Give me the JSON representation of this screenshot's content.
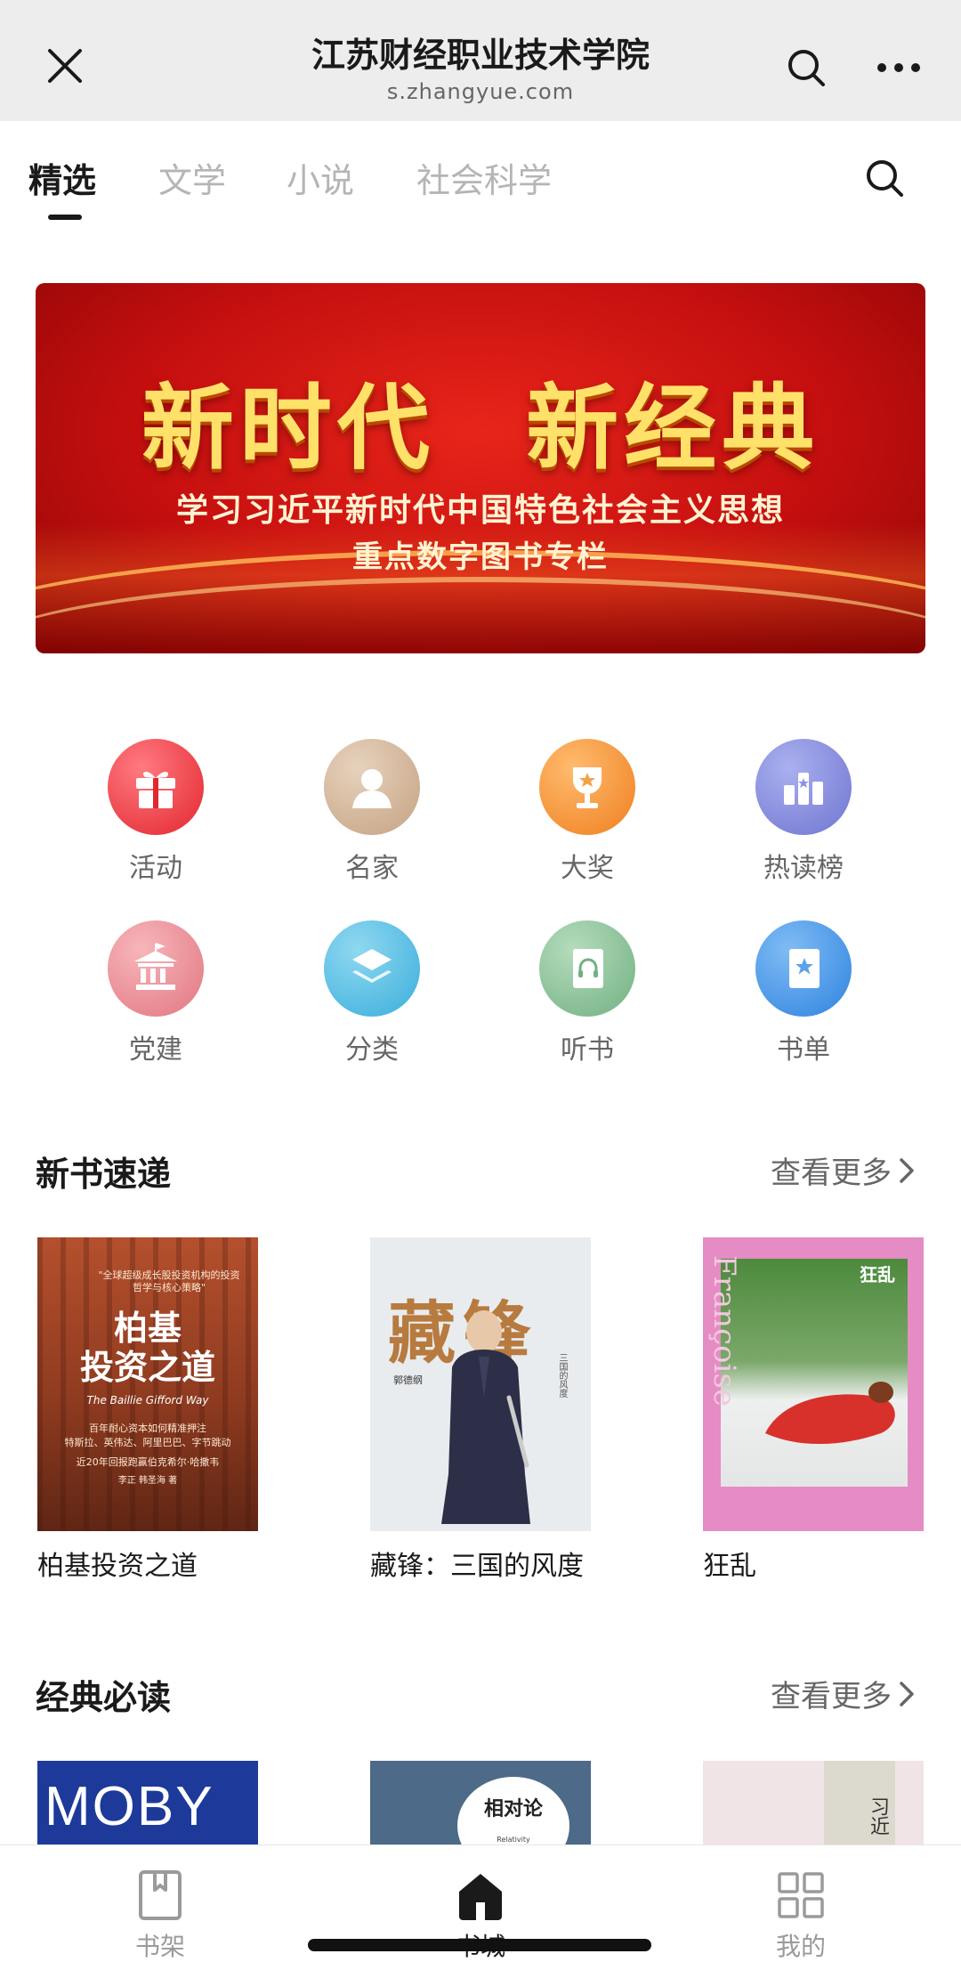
{
  "topbar": {
    "title": "江苏财经职业技术学院",
    "subtitle": "s.zhangyue.com",
    "close_icon": "close-icon",
    "search_icon": "search-icon",
    "more_icon": "more-icon"
  },
  "tabs": [
    {
      "label": "精选",
      "active": true
    },
    {
      "label": "文学",
      "active": false
    },
    {
      "label": "小说",
      "active": false
    },
    {
      "label": "社会科学",
      "active": false
    }
  ],
  "banner": {
    "headline": "新时代 新经典",
    "line1": "学习习近平新时代中国特色社会主义思想",
    "line2": "重点数字图书专栏"
  },
  "shortcuts": [
    {
      "label": "活动",
      "icon": "gift-icon",
      "color": "#e8323c"
    },
    {
      "label": "名家",
      "icon": "person-icon",
      "color": "#c8a98a"
    },
    {
      "label": "大奖",
      "icon": "trophy-icon",
      "color": "#f08a2e"
    },
    {
      "label": "热读榜",
      "icon": "ranking-icon",
      "color": "#7f85d8"
    },
    {
      "label": "党建",
      "icon": "building-icon",
      "color": "#e47a84"
    },
    {
      "label": "分类",
      "icon": "layers-icon",
      "color": "#46b6df"
    },
    {
      "label": "听书",
      "icon": "headphones-book-icon",
      "color": "#7eb88a"
    },
    {
      "label": "书单",
      "icon": "booklist-icon",
      "color": "#3f90e6"
    }
  ],
  "new_books": {
    "title": "新书速递",
    "more": "查看更多",
    "books": [
      {
        "name": "柏基投资之道",
        "cover_title": "柏基\n投资之道",
        "cover_subtitle": "The Baillie Gifford Way",
        "cover_quote": "\"全球超级成长股投资机构的投资哲学与核心策略\"",
        "cover_note1": "百年耐心资本如何精准押注",
        "cover_note2": "特斯拉、英伟达、阿里巴巴、字节跳动",
        "cover_note3": "近20年回报跑赢伯克希尔·哈撒韦",
        "cover_authors": "李正  韩圣海  著"
      },
      {
        "name": "藏锋：三国的风度",
        "cover_title": "藏锋",
        "cover_author": "郭德纲",
        "cover_side": "三国的风度"
      },
      {
        "name": "狂乱",
        "cover_title": "狂乱",
        "cover_author_name": "Françoise Sagan"
      }
    ]
  },
  "classics": {
    "title": "经典必读",
    "more": "查看更多",
    "books": [
      {
        "cover_title": "MOBY DICK"
      },
      {
        "cover_title": "相对论",
        "cover_subtitle": "Relativity"
      },
      {
        "cover_title": "习近"
      }
    ]
  },
  "bottom_nav": [
    {
      "label": "书架",
      "icon": "bookshelf-icon",
      "active": false
    },
    {
      "label": "书城",
      "icon": "home-icon",
      "active": true
    },
    {
      "label": "我的",
      "icon": "grid-icon",
      "active": false
    }
  ]
}
